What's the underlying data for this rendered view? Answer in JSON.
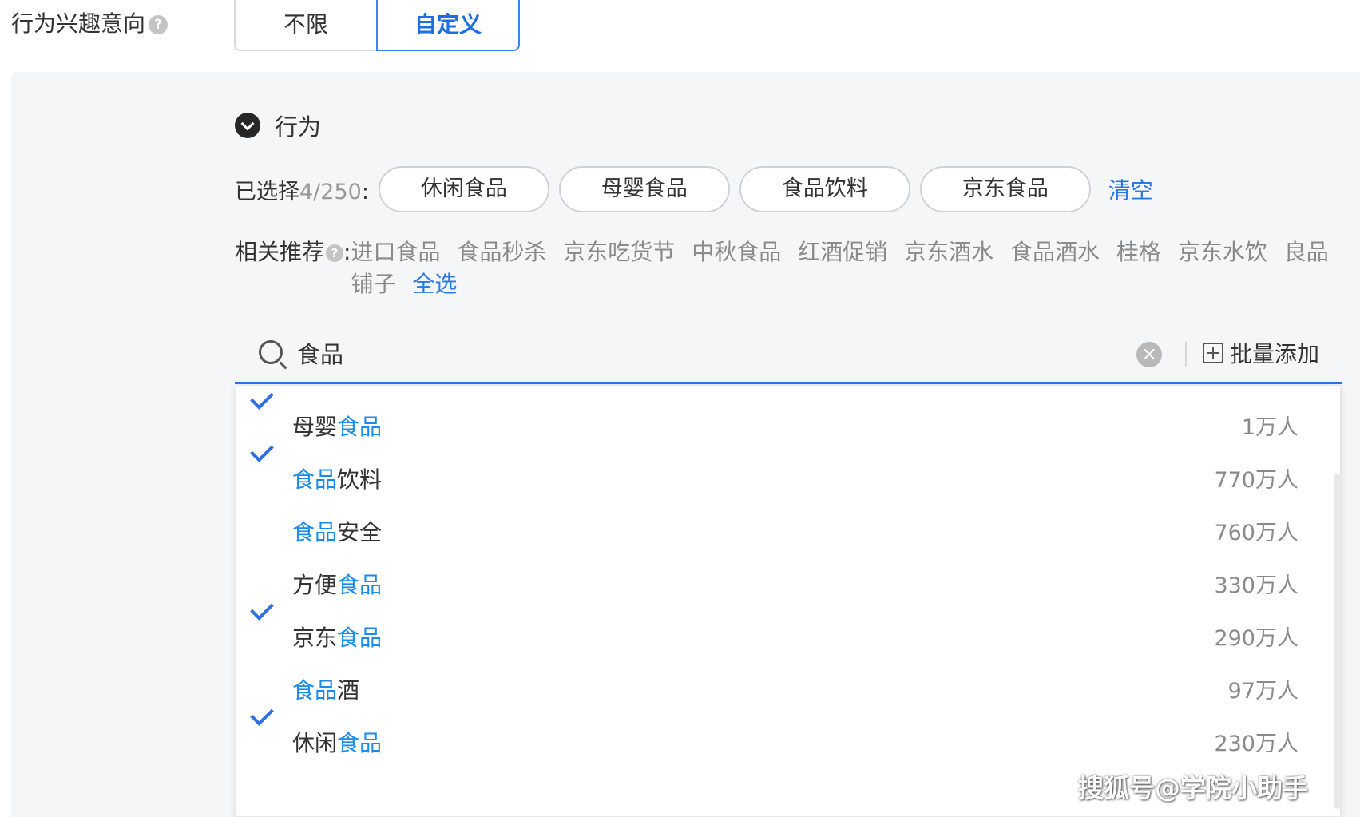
{
  "field": {
    "label": "行为兴趣意向",
    "help": "?"
  },
  "mode": {
    "unlimited": "不限",
    "custom": "自定义",
    "selected": "custom"
  },
  "section": {
    "title": "行为"
  },
  "selected": {
    "label": "已选择",
    "count": "4/250",
    "suffix": ":",
    "chips": [
      "休闲食品",
      "母婴食品",
      "食品饮料",
      "京东食品"
    ],
    "clear": "清空"
  },
  "recommend": {
    "label": "相关推荐",
    "help": "?",
    "colon": ":",
    "items": [
      "进口食品",
      "食品秒杀",
      "京东吃货节",
      "中秋食品",
      "红酒促销",
      "京东酒水",
      "食品酒水",
      "桂格",
      "京东水饮",
      "良品铺子"
    ],
    "select_all": "全选"
  },
  "search": {
    "value": "食品",
    "clear_symbol": "×",
    "batch_add": "批量添加"
  },
  "results": [
    {
      "pre": "母婴",
      "hl": "食品",
      "post": "",
      "count": "1万人",
      "checked": true
    },
    {
      "pre": "",
      "hl": "食品",
      "post": "饮料",
      "count": "770万人",
      "checked": true
    },
    {
      "pre": "",
      "hl": "食品",
      "post": "安全",
      "count": "760万人",
      "checked": false
    },
    {
      "pre": "方便",
      "hl": "食品",
      "post": "",
      "count": "330万人",
      "checked": false
    },
    {
      "pre": "京东",
      "hl": "食品",
      "post": "",
      "count": "290万人",
      "checked": true
    },
    {
      "pre": "",
      "hl": "食品",
      "post": "酒",
      "count": "97万人",
      "checked": false
    },
    {
      "pre": "休闲",
      "hl": "食品",
      "post": "",
      "count": "230万人",
      "checked": true
    }
  ],
  "watermark": "搜狐号@学院小助手",
  "colors": {
    "accent": "#2f74ec",
    "highlight": "#1c8ae8",
    "panel": "#f5f6f7"
  }
}
